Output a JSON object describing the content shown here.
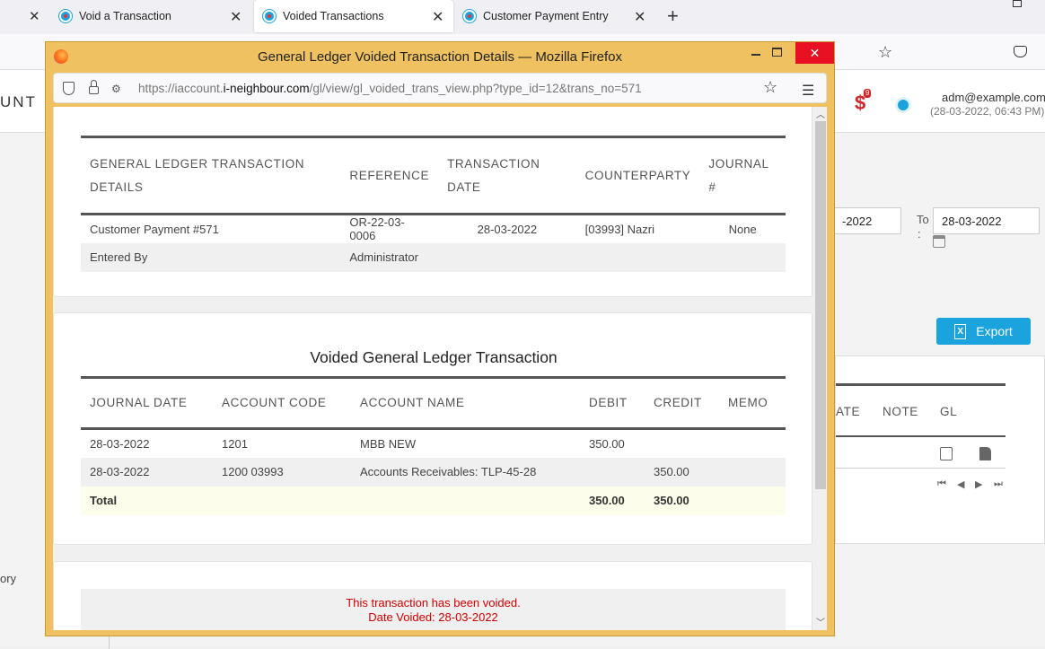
{
  "browser": {
    "tabs": [
      {
        "label": "Void a Transaction"
      },
      {
        "label": "Voided Transactions"
      },
      {
        "label": "Customer Payment Entry"
      }
    ],
    "new_tab": "+",
    "close_glyph": "✕"
  },
  "background_app": {
    "brand_partial": "UNT",
    "notification_count": "9",
    "user_email": "adm@example.com",
    "user_datetime": "(28-03-2022, 06:43 PM)",
    "from_date_partial": "-2022",
    "to_label": "To",
    "to_colon": ":",
    "to_date": "28-03-2022",
    "export_label": "Export",
    "table_headers": [
      "ATE",
      "NOTE",
      "GL"
    ],
    "sidebar_partial": "ory"
  },
  "popup": {
    "title": "General Ledger Voided Transaction Details — Mozilla Firefox",
    "url_prefix": "https://iaccount.",
    "url_domain": "i-neighbour.com",
    "url_path": "/gl/view/gl_voided_trans_view.php?type_id=12&trans_no=571"
  },
  "details": {
    "headers": [
      "GENERAL LEDGER TRANSACTION DETAILS",
      "REFERENCE",
      "TRANSACTION DATE",
      "COUNTERPARTY",
      "JOURNAL #"
    ],
    "row": {
      "description": "Customer Payment #571",
      "reference": "OR-22-03-0006",
      "date": "28-03-2022",
      "counterparty": "[03993] Nazri",
      "journal": "None"
    },
    "entered_by_label": "Entered By",
    "entered_by_value": "Administrator"
  },
  "voided": {
    "title": "Voided General Ledger Transaction",
    "headers": [
      "JOURNAL DATE",
      "ACCOUNT CODE",
      "ACCOUNT NAME",
      "DEBIT",
      "CREDIT",
      "MEMO"
    ],
    "rows": [
      {
        "date": "28-03-2022",
        "code": "1201",
        "name": "MBB NEW",
        "debit": "350.00",
        "credit": "",
        "memo": ""
      },
      {
        "date": "28-03-2022",
        "code": "1200 03993",
        "name": "Accounts Receivables: TLP-45-28",
        "debit": "",
        "credit": "350.00",
        "memo": ""
      }
    ],
    "total_label": "Total",
    "total_debit": "350.00",
    "total_credit": "350.00"
  },
  "notice": {
    "line1": "This transaction has been voided.",
    "line2": "Date Voided: 28-03-2022"
  }
}
